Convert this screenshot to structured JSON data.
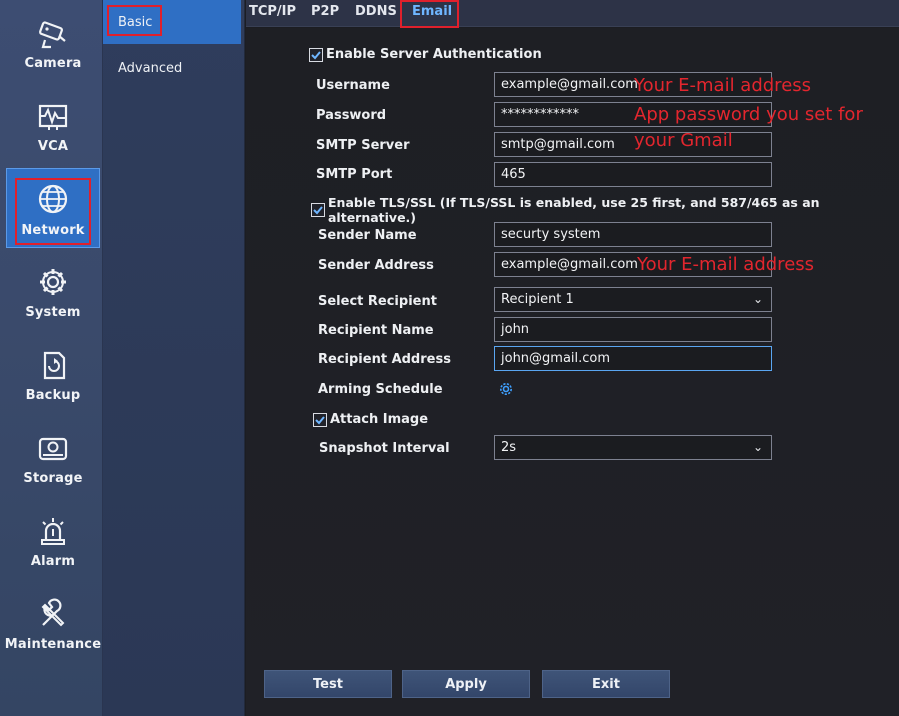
{
  "rail": {
    "items": [
      {
        "label": "Camera",
        "icon": "camera-icon"
      },
      {
        "label": "VCA",
        "icon": "vca-icon"
      },
      {
        "label": "Network",
        "icon": "globe-icon"
      },
      {
        "label": "System",
        "icon": "gear-icon"
      },
      {
        "label": "Backup",
        "icon": "backup-icon"
      },
      {
        "label": "Storage",
        "icon": "hard-drive-icon"
      },
      {
        "label": "Alarm",
        "icon": "alarm-icon"
      },
      {
        "label": "Maintenance",
        "icon": "tools-icon"
      }
    ],
    "active": "Network"
  },
  "submenu": {
    "items": [
      {
        "label": "Basic"
      },
      {
        "label": "Advanced"
      }
    ],
    "active": "Basic"
  },
  "tabs": {
    "items": [
      {
        "label": "TCP/IP"
      },
      {
        "label": "P2P"
      },
      {
        "label": "DDNS"
      },
      {
        "label": "Email"
      }
    ],
    "active": "Email"
  },
  "form": {
    "enable_auth_label": "Enable Server Authentication",
    "username_label": "Username",
    "username_value": "example@gmail.com",
    "password_label": "Password",
    "password_value": "************",
    "smtp_server_label": "SMTP Server",
    "smtp_server_value": "smtp@gmail.com",
    "smtp_port_label": "SMTP Port",
    "smtp_port_value": "465",
    "tls_label": "Enable TLS/SSL (If TLS/SSL is enabled, use 25 first, and 587/465 as an alternative.)",
    "sender_name_label": "Sender Name",
    "sender_name_value": "securty system",
    "sender_address_label": "Sender Address",
    "sender_address_value": "example@gmail.com",
    "select_recipient_label": "Select Recipient",
    "select_recipient_value": "Recipient 1",
    "recipient_name_label": "Recipient Name",
    "recipient_name_value": "john",
    "recipient_address_label": "Recipient Address",
    "recipient_address_value": "john@gmail.com",
    "arming_schedule_label": "Arming Schedule",
    "attach_image_label": "Attach Image",
    "snapshot_interval_label": "Snapshot Interval",
    "snapshot_interval_value": "2s"
  },
  "annotations": {
    "username_note": "Your E-mail address",
    "password_note_line1": "App password you set for",
    "password_note_line2": "your Gmail",
    "sender_note": "Your E-mail address"
  },
  "buttons": {
    "test": "Test",
    "apply": "Apply",
    "exit": "Exit"
  },
  "colors": {
    "accent": "#2f6fc4",
    "highlight_box": "#e0202c",
    "annotation": "#e3262e",
    "active_tab": "#6fb6ff"
  }
}
